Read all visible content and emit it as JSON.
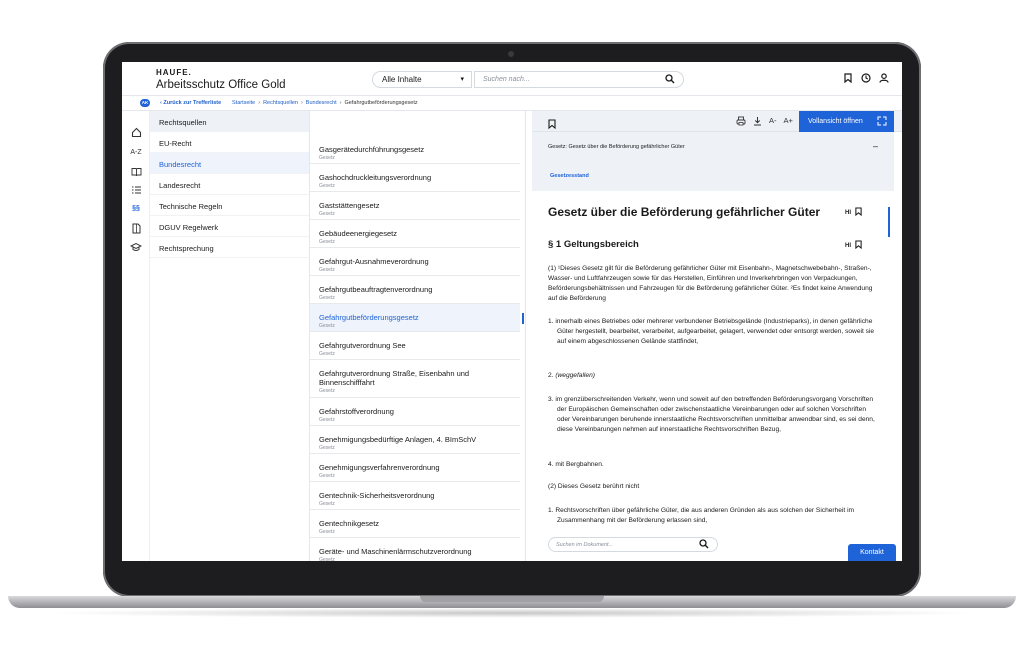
{
  "header": {
    "brand": "HAUFE.",
    "product": "Arbeitsschutz Office Gold",
    "scope": "Alle Inhalte",
    "search_placeholder": "Suchen nach..."
  },
  "breadcrumb": {
    "badge": "AK",
    "back": "Zurück zur Trefferliste",
    "items": [
      "Startseite",
      "Rechtsquellen",
      "Bundesrecht",
      "Gefahrgutbeförderungsgesetz"
    ]
  },
  "rail": {
    "items": [
      "home",
      "A-Z",
      "book",
      "list",
      "§§",
      "document",
      "graduation"
    ]
  },
  "categories": {
    "header": "Rechtsquellen",
    "items": [
      "EU-Recht",
      "Bundesrecht",
      "Landesrecht",
      "Technische Regeln",
      "DGUV Regelwerk",
      "Rechtsprechung"
    ]
  },
  "laws": [
    {
      "title": "Gasgerätedurchführungsgesetz",
      "type": "Gesetz"
    },
    {
      "title": "Gashochdruckleitungsverordnung",
      "type": "Gesetz"
    },
    {
      "title": "Gaststättengesetz",
      "type": "Gesetz"
    },
    {
      "title": "Gebäudeenergiegesetz",
      "type": "Gesetz"
    },
    {
      "title": "Gefahrgut-Ausnahmeverordnung",
      "type": "Gesetz"
    },
    {
      "title": "Gefahrgutbeauftragtenverordnung",
      "type": "Gesetz"
    },
    {
      "title": "Gefahrgutbeförderungsgesetz",
      "type": "Gesetz"
    },
    {
      "title": "Gefahrgutverordnung See",
      "type": "Gesetz"
    },
    {
      "title": "Gefahrgutverordnung Straße, Eisenbahn und Binnenschifffahrt",
      "type": "Gesetz"
    },
    {
      "title": "Gefahrstoffverordnung",
      "type": "Gesetz"
    },
    {
      "title": "Genehmigungsbedürftige Anlagen, 4. BImSchV",
      "type": "Gesetz"
    },
    {
      "title": "Genehmigungsverfahrenverordnung",
      "type": "Gesetz"
    },
    {
      "title": "Gentechnik-Sicherheitsverordnung",
      "type": "Gesetz"
    },
    {
      "title": "Gentechnikgesetz",
      "type": "Gesetz"
    },
    {
      "title": "Geräte- und Maschinenlärmschutzverordnung",
      "type": "Gesetz"
    }
  ],
  "doc": {
    "toolbar": {
      "font_smaller": "A-",
      "font_larger": "A+",
      "fullview": "Vollansicht öffnen"
    },
    "context_title": "Gesetz: Gesetz über die Beförderung gefährlicher Güter",
    "collapse": "–",
    "status": "Gesetzesstand",
    "title": "Gesetz über die Beförderung gefährlicher Güter",
    "section": "§ 1 Geltungsbereich",
    "hi_label": "HI",
    "paragraphs": [
      "(1) ¹Dieses Gesetz gilt für die Beförderung gefährlicher Güter mit Eisenbahn-, Magnetschwebebahn-, Straßen-, Wasser- und Luftfahrzeugen sowie für das Herstellen, Einführen und Inverkehrbringen von Verpackungen, Beförderungsbehältnissen und Fahrzeugen für die Beförderung gefährlicher Güter. ²Es findet keine Anwendung auf die Beförderung",
      "1. innerhalb eines Betriebes oder mehrerer verbundener Betriebsgelände (Industrieparks), in denen gefährliche Güter hergestellt, bearbeitet, verarbeitet, aufgearbeitet, gelagert, verwendet oder entsorgt werden, soweit sie auf einem abgeschlossenen Gelände stattfindet,",
      "(weggefallen)",
      "3. im grenzüberschreitenden Verkehr, wenn und soweit auf den betreffenden Beförderungsvorgang Vorschriften der Europäischen Gemeinschaften oder zwischenstaatliche Vereinbarungen oder auf solchen Vorschriften oder Vereinbarungen beruhende innerstaatliche Rechtsvorschriften unmittelbar anwendbar sind, es sei denn, diese Vereinbarungen nehmen auf innerstaatliche Rechtsvorschriften Bezug,",
      "4. mit Bergbahnen.",
      "(2) Dieses Gesetz berührt nicht",
      "1. Rechtsvorschriften über gefährliche Güter, die aus anderen Gründen als aus solchen der Sicherheit im Zusammenhang mit der Beförderung erlassen sind,"
    ],
    "para2_number": "2.",
    "search_placeholder": "Suchen im Dokument...",
    "contact": "Kontakt"
  },
  "colors": {
    "accent": "#1f63d8",
    "panel_bg": "#eef1f6",
    "frame": "#1d1d1f"
  }
}
